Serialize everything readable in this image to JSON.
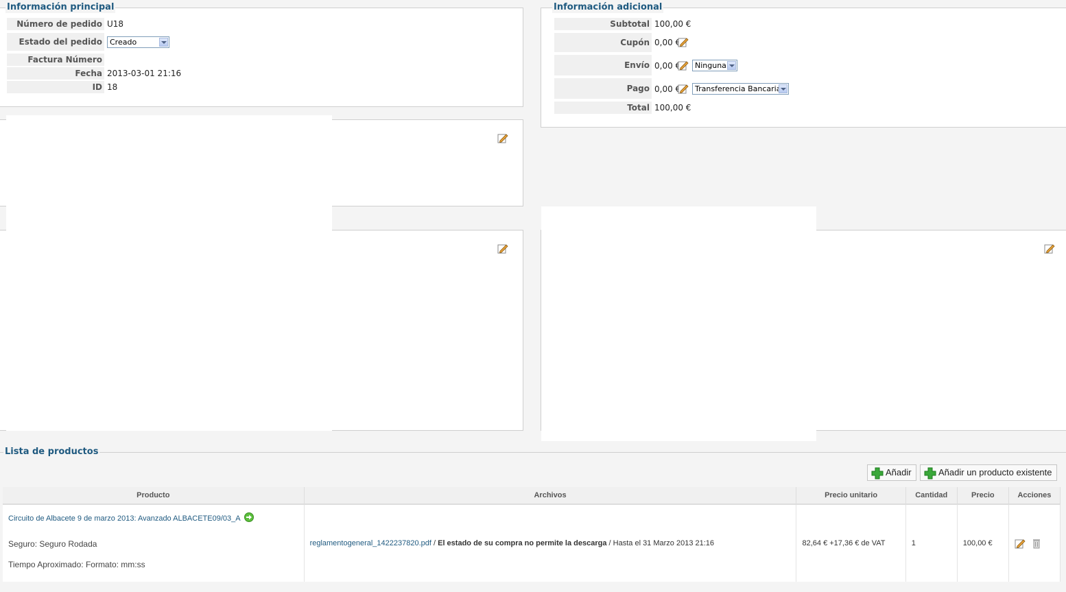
{
  "main_info": {
    "legend": "Información principal",
    "order_number_label": "Número de pedido",
    "order_number": "U18",
    "status_label": "Estado del pedido",
    "status_value": "Creado",
    "invoice_label": "Factura Número",
    "invoice_value": "",
    "date_label": "Fecha",
    "date_value": "2013-03-01 21:16",
    "id_label": "ID",
    "id_value": "18"
  },
  "additional_info": {
    "legend": "Información adicional",
    "subtotal_label": "Subtotal",
    "subtotal_value": "100,00 €",
    "coupon_label": "Cupón",
    "coupon_value": "0,00 €",
    "shipping_label": "Envío",
    "shipping_value": "0,00 €",
    "shipping_method": "Ninguna",
    "payment_label": "Pago",
    "payment_value": "0,00 €",
    "payment_method": "Transferencia Bancaria",
    "total_label": "Total",
    "total_value": "100,00 €"
  },
  "products": {
    "legend": "Lista de productos",
    "add_button": "Añadir",
    "add_existing_button": "Añadir un producto existente",
    "columns": [
      "Producto",
      "Archivos",
      "Precio unitario",
      "Cantidad",
      "Precio",
      "Acciones"
    ],
    "rows": [
      {
        "product_name": "Circuito de Albacete 9 de marzo 2013: Avanzado ALBACETE09/03_A",
        "option_1": "Seguro: Seguro Rodada",
        "option_2": "Tiempo Aproximado: Formato: mm:ss",
        "file_name": "reglamentogeneral_1422237820.pdf",
        "file_sep1": " / ",
        "file_status": "El estado de su compra no permite la descarga",
        "file_sep2": " / ",
        "file_until": "Hasta el 31 Marzo 2013 21:16",
        "unit_price": "82,64 € +17,36 € de VAT",
        "quantity": "1",
        "price": "100,00 €"
      }
    ]
  },
  "icons": {
    "edit": "edit-icon",
    "delete": "trash-icon",
    "go": "arrow-right-icon",
    "add": "plus-icon"
  },
  "colors": {
    "legend": "#1f5a80",
    "add_green": "#3aa83a"
  }
}
